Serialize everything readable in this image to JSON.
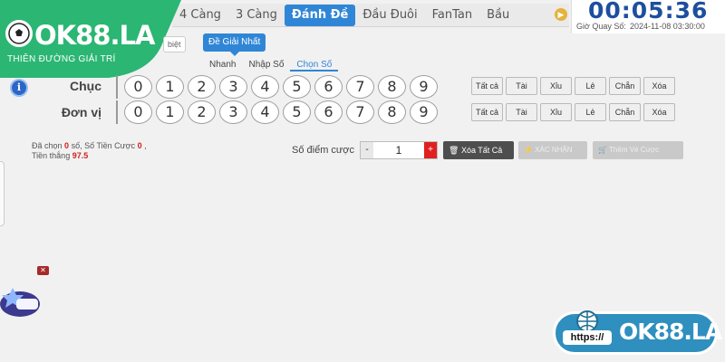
{
  "tabs": [
    {
      "label": "4 Càng",
      "active": false
    },
    {
      "label": "3 Càng",
      "active": false
    },
    {
      "label": "Đánh Đề",
      "active": true
    },
    {
      "label": "Đầu Đuôi",
      "active": false
    },
    {
      "label": "FanTan",
      "active": false
    },
    {
      "label": "Bầu",
      "active": false
    }
  ],
  "timer": {
    "countdown": "00:05:36",
    "draw_label": "Giờ Quay Số:",
    "draw_time": "2024-11-08 03:30:00"
  },
  "brand": {
    "logo": "OK88.LA",
    "slogan": "THIÊN ĐƯỜNG GIẢI TRÍ"
  },
  "mode_badge": "biệt",
  "prize_tab": "Đề Giải Nhất",
  "submodes": [
    {
      "label": "Nhanh",
      "active": false
    },
    {
      "label": "Nhập Số",
      "active": false
    },
    {
      "label": "Chọn Số",
      "active": true
    }
  ],
  "rows": [
    {
      "label": "Chục",
      "numbers": [
        "0",
        "1",
        "2",
        "3",
        "4",
        "5",
        "6",
        "7",
        "8",
        "9"
      ]
    },
    {
      "label": "Đơn vị",
      "numbers": [
        "0",
        "1",
        "2",
        "3",
        "4",
        "5",
        "6",
        "7",
        "8",
        "9"
      ]
    }
  ],
  "quick_buttons": [
    "Tất cả",
    "Tài",
    "Xỉu",
    "Lẻ",
    "Chẵn",
    "Xóa"
  ],
  "summary": {
    "selected_label": "Đã chọn",
    "selected_value": "0",
    "selected_unit": "số,",
    "bet_amount_label": "Số Tiền Cược",
    "bet_amount_value": "0",
    "bet_amount_suffix": ",",
    "win_label": "Tiền thắng",
    "win_value": "97.5"
  },
  "bet": {
    "label": "Số điểm cược",
    "minus": "-",
    "value": "1",
    "plus": "+"
  },
  "buttons": {
    "clear_all": "Xóa Tất Cả",
    "confirm": "XÁC NHẬN",
    "add_bet": "Thêm Vé Cược"
  },
  "promo": {
    "http": "https://",
    "text": "OK88.LA"
  },
  "colors": {
    "active_tab": "#2f86d6",
    "timer": "#1d4f9e",
    "logo_green": "#2bb673",
    "highlight_red": "#d32020"
  }
}
